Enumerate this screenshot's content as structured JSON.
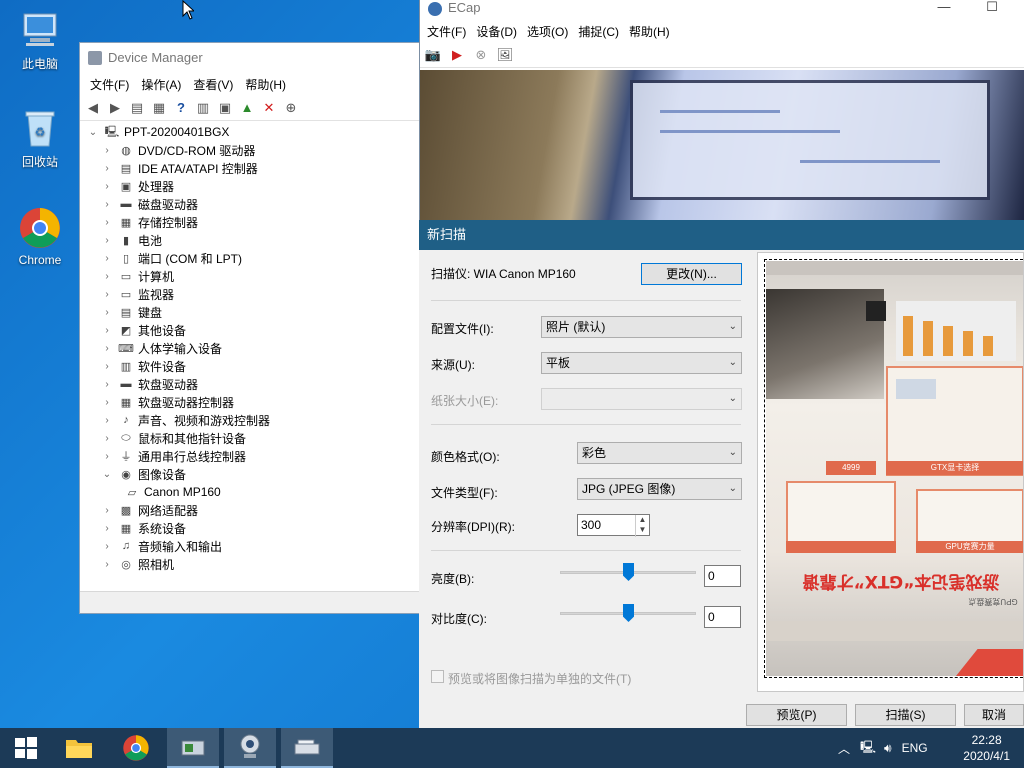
{
  "desktop": {
    "icons": [
      {
        "label": "此电脑"
      },
      {
        "label": "回收站"
      },
      {
        "label": "Chrome"
      }
    ]
  },
  "device_manager": {
    "title": "Device Manager",
    "menu": [
      "文件(F)",
      "操作(A)",
      "查看(V)",
      "帮助(H)"
    ],
    "tree": {
      "root": "PPT-20200401BGX",
      "items": [
        {
          "label": "DVD/CD-ROM 驱动器",
          "icon": "dvd-icon"
        },
        {
          "label": "IDE ATA/ATAPI 控制器",
          "icon": "ide-controller-icon"
        },
        {
          "label": "处理器",
          "icon": "processor-icon"
        },
        {
          "label": "磁盘驱动器",
          "icon": "disk-drive-icon"
        },
        {
          "label": "存储控制器",
          "icon": "storage-controller-icon"
        },
        {
          "label": "电池",
          "icon": "battery-icon"
        },
        {
          "label": "端口 (COM 和 LPT)",
          "icon": "port-icon"
        },
        {
          "label": "计算机",
          "icon": "computer-icon"
        },
        {
          "label": "监视器",
          "icon": "monitor-icon"
        },
        {
          "label": "键盘",
          "icon": "keyboard-icon"
        },
        {
          "label": "其他设备",
          "icon": "other-devices-icon"
        },
        {
          "label": "人体学输入设备",
          "icon": "hid-icon"
        },
        {
          "label": "软件设备",
          "icon": "software-device-icon"
        },
        {
          "label": "软盘驱动器",
          "icon": "floppy-drive-icon"
        },
        {
          "label": "软盘驱动器控制器",
          "icon": "floppy-controller-icon"
        },
        {
          "label": "声音、视频和游戏控制器",
          "icon": "sound-icon"
        },
        {
          "label": "鼠标和其他指针设备",
          "icon": "mouse-icon"
        },
        {
          "label": "通用串行总线控制器",
          "icon": "usb-icon"
        },
        {
          "label": "图像设备",
          "icon": "imaging-device-icon",
          "expanded": true
        },
        {
          "label": "Canon MP160",
          "icon": "scanner-icon",
          "child": true
        },
        {
          "label": "网络适配器",
          "icon": "network-adapter-icon"
        },
        {
          "label": "系统设备",
          "icon": "system-device-icon"
        },
        {
          "label": "音频输入和输出",
          "icon": "audio-io-icon"
        },
        {
          "label": "照相机",
          "icon": "camera-icon"
        }
      ]
    }
  },
  "ecap": {
    "title": "ECap",
    "menu": [
      "文件(F)",
      "设备(D)",
      "选项(O)",
      "捕捉(C)",
      "帮助(H)"
    ]
  },
  "scan_dialog": {
    "title": "新扫描",
    "scanner_label": "扫描仪: WIA Canon MP160",
    "change_button": "更改(N)...",
    "profile_label": "配置文件(I):",
    "profile_value": "照片 (默认)",
    "source_label": "来源(U):",
    "source_value": "平板",
    "paper_size_label": "纸张大小(E):",
    "paper_size_value": "",
    "color_format_label": "颜色格式(O):",
    "color_format_value": "彩色",
    "file_type_label": "文件类型(F):",
    "file_type_value": "JPG (JPEG 图像)",
    "resolution_label": "分辨率(DPI)(R):",
    "resolution_value": "300",
    "brightness_label": "亮度(B):",
    "brightness_value": "0",
    "contrast_label": "对比度(C):",
    "contrast_value": "0",
    "separate_files_label": "预览或将图像扫描为单独的文件(T)",
    "preview_button": "预览(P)",
    "scan_button": "扫描(S)",
    "cancel_button": "取消",
    "preview_text": {
      "headline": "游戏笔记本“GTX”才靠谱",
      "tag": "GPU竞赛盘点",
      "price": "4999",
      "box1": "GTX显卡选择",
      "box2": "GPU竞赛力量"
    }
  },
  "taskbar": {
    "language": "ENG",
    "time": "22:28",
    "date": "2020/4/1"
  },
  "colors": {
    "desktop": "#1580d6",
    "taskbar": "#1c3a57",
    "dialog_title": "#1f5f86",
    "accent": "#0078d7"
  }
}
